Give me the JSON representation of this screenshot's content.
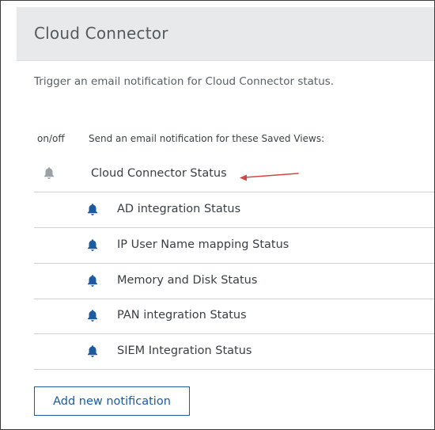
{
  "header": {
    "title": "Cloud Connector"
  },
  "description": "Trigger an email notification for Cloud Connector status.",
  "columns": {
    "toggle": "on/off",
    "views": "Send an email notification for these Saved Views:"
  },
  "parent_view": {
    "label": "Cloud Connector Status",
    "icon": "bell-icon",
    "state": "off",
    "icon_color": "#9aa0a6"
  },
  "saved_views": [
    {
      "label": "AD integration Status",
      "icon": "bell-icon",
      "state": "on"
    },
    {
      "label": "IP User Name mapping Status",
      "icon": "bell-icon",
      "state": "on"
    },
    {
      "label": "Memory and Disk Status",
      "icon": "bell-icon",
      "state": "on"
    },
    {
      "label": "PAN integration Status",
      "icon": "bell-icon",
      "state": "on"
    },
    {
      "label": "SIEM Integration Status",
      "icon": "bell-icon",
      "state": "on"
    }
  ],
  "colors": {
    "bell_on": "#1d5aa0",
    "bell_off": "#9aa0a6",
    "annotation_arrow": "#d64545",
    "button_accent": "#1d5aa0"
  },
  "add_button": {
    "label": "Add new notification"
  }
}
